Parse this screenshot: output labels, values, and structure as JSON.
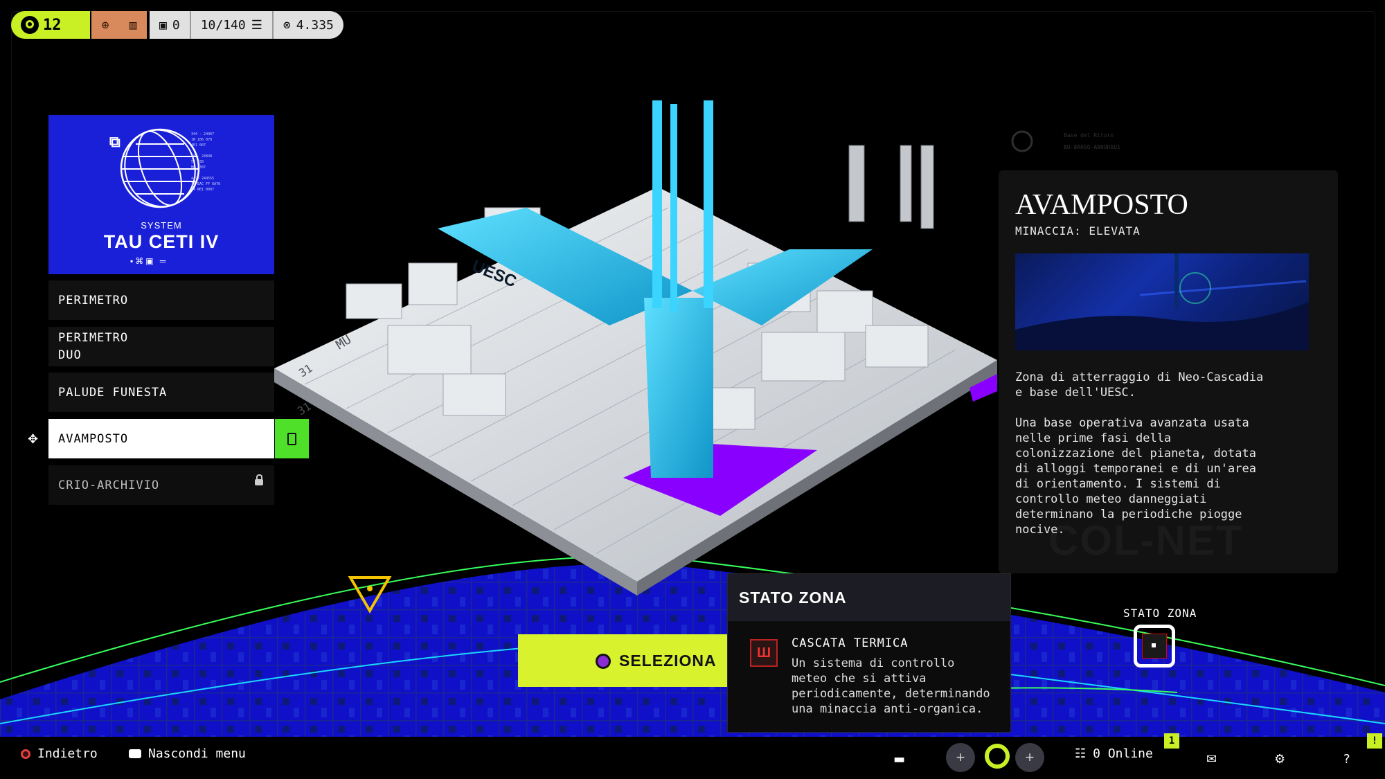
{
  "hud": {
    "level": "12",
    "inventory_count": "0",
    "capacity": "10/140",
    "currency": "4.335"
  },
  "system": {
    "label": "SYSTEM",
    "name": "TAU CETI IV",
    "tiny_lines": [
      "344 - 24967",
      "1N 106 078",
      "4E1 007",
      "28 - 24848",
      "54 838",
      "ME 8307",
      "4497 244555",
      "1A EAC FF 6A76",
      "74 NEI 0007"
    ]
  },
  "zones": [
    {
      "label": "PERIMETRO"
    },
    {
      "label": "PERIMETRO\nDUO"
    },
    {
      "label": "PALUDE FUNESTA"
    },
    {
      "label": "AVAMPOSTO"
    },
    {
      "label": "CRIO-ARCHIVIO"
    }
  ],
  "map": {
    "building_label": "UESC",
    "grid_labels": [
      "MU",
      "31",
      "31"
    ],
    "corner_label_top": "Base del Ritoro",
    "corner_label_bottom": "BU-8A0SO-A80UR0U1"
  },
  "detail": {
    "title": "AVAMPOSTO",
    "threat": "MINACCIA: ELEVATA",
    "description": "Zona di atterraggio di Neo-Cascadia\ne base dell'UESC.\n\nUna base operativa avanzata usata\nnelle prime fasi della\ncolonizzazione del pianeta, dotata\ndi alloggi temporanei e di un'area\ndi orientamento. I sistemi di\ncontrollo meteo danneggiati\ndeterminano la periodiche piogge\nnocive.",
    "watermark": "COL-NET",
    "status_label": "STATO ZONA"
  },
  "popup": {
    "title": "STATO ZONA",
    "condition_name": "CASCATA TERMICA",
    "condition_desc": "Un sistema di controllo\nmeteo che si attiva\nperiodicamente, determinando\nuna minaccia anti-organica."
  },
  "select_button": "SELEZIONA",
  "bottom": {
    "back": "Indietro",
    "hide_menu": "Nascondi menu",
    "online": "0 Online",
    "badge_social": "1",
    "badge_corner": "!"
  },
  "colors": {
    "accent": "#c8f025",
    "system_card": "#1a20d8",
    "purple_zone": "#8a00ff",
    "cyan_building": "#2bc8f0",
    "active_tab": "#4fe02a"
  }
}
